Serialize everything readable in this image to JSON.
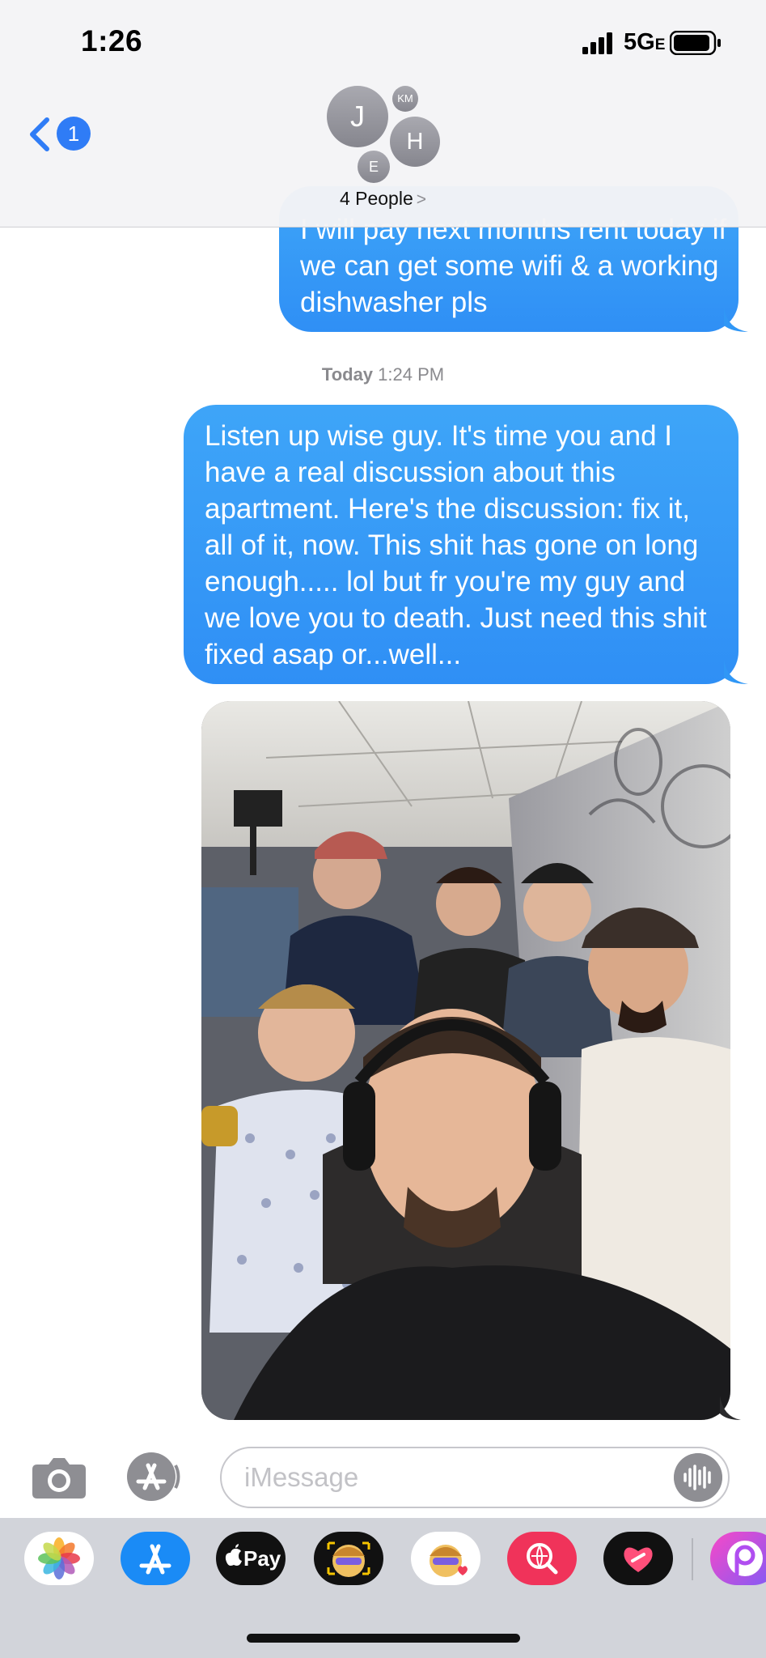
{
  "status_bar": {
    "time": "1:26",
    "network": "5G",
    "network_suffix": "E"
  },
  "header": {
    "back_badge_count": "1",
    "avatars": [
      {
        "initials": "J"
      },
      {
        "initials": "KM"
      },
      {
        "initials": "H"
      },
      {
        "initials": "E"
      }
    ],
    "people_label": "4 People",
    "people_chevron": ">"
  },
  "conversation": {
    "previous_message": "I will pay next months rent today if we can get some wifi & a working dishwasher pls",
    "timestamp_day": "Today",
    "timestamp_time": "1:24 PM",
    "main_message": "Listen up wise guy. It's time you and I have a real discussion about this apartment. Here's the discussion: fix it, all of it, now. This shit has gone on long enough..... lol but fr you're my guy and we love you to death. Just need this shit fixed asap or...well..."
  },
  "compose": {
    "placeholder": "iMessage"
  },
  "app_drawer": {
    "apps": [
      "photos-icon",
      "app-store-icon",
      "apple-pay-icon",
      "memoji-icon",
      "memoji-stickers-icon",
      "search-images-icon",
      "heart-app-icon",
      "picsart-icon"
    ],
    "pay_label": "Pay"
  },
  "colors": {
    "bubble_blue": "#3ea5f8",
    "badge_blue": "#2f7cf6",
    "back_blue": "#2f7cf6",
    "header_bg": "#f4f4f6",
    "drawer_bg": "#d2d4da"
  }
}
